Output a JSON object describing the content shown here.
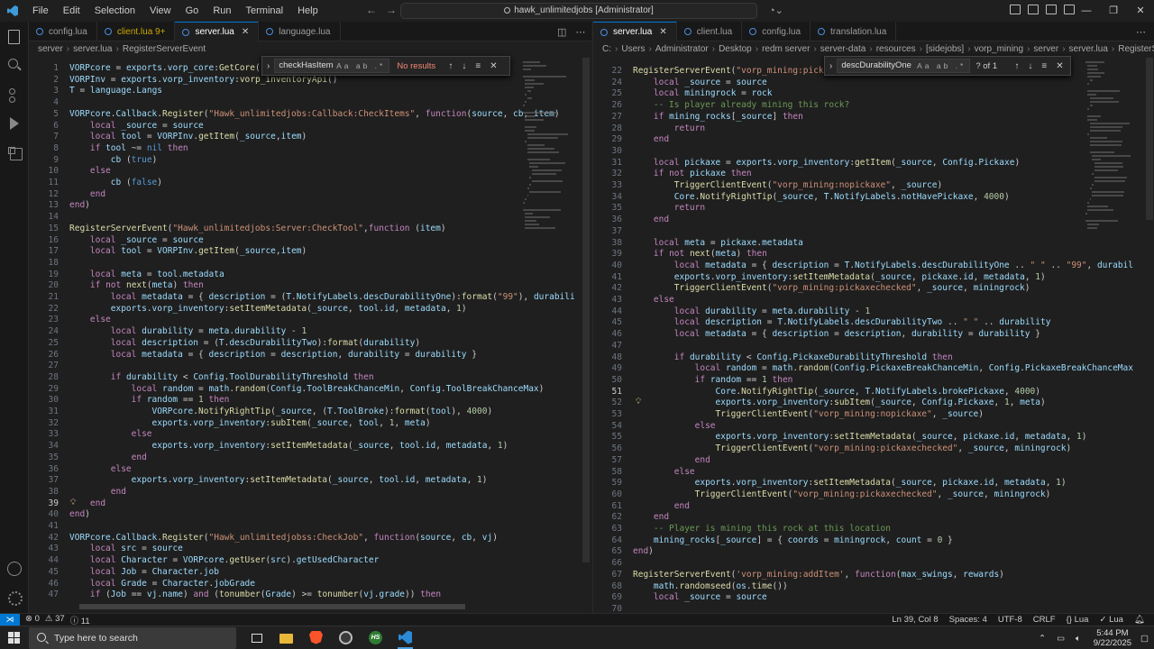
{
  "window": {
    "title": "hawk_unlimitedjobs [Administrator]"
  },
  "menu": [
    "File",
    "Edit",
    "Selection",
    "View",
    "Go",
    "Run",
    "Terminal",
    "Help"
  ],
  "left": {
    "tabs": [
      {
        "label": "config.lua",
        "active": false,
        "mod": false
      },
      {
        "label": "client.lua 9+",
        "active": false,
        "mod": true
      },
      {
        "label": "server.lua",
        "active": true,
        "mod": false
      },
      {
        "label": "language.lua",
        "active": false,
        "mod": false
      }
    ],
    "breadcrumb": [
      "server",
      "server.lua",
      "RegisterServerEvent"
    ],
    "find": {
      "query": "checkHasItem",
      "result": "No results"
    },
    "lines": [
      {
        "n": "1",
        "t": "VORPcore = exports.vorp_core:GetCore()"
      },
      {
        "n": "2",
        "t": "VORPInv = exports.vorp_inventory:vorp_inventoryApi()"
      },
      {
        "n": "3",
        "t": "T = language.Langs"
      },
      {
        "n": "4",
        "t": ""
      },
      {
        "n": "5",
        "t": "VORPcore.Callback.Register(\"Hawk_unlimitedjobs:Callback:CheckItems\", function(source, cb, item)"
      },
      {
        "n": "6",
        "t": "    local _source = source"
      },
      {
        "n": "7",
        "t": "    local tool = VORPInv.getItem(_source,item)"
      },
      {
        "n": "8",
        "t": "    if tool ~= nil then"
      },
      {
        "n": "9",
        "t": "        cb (true)"
      },
      {
        "n": "10",
        "t": "    else"
      },
      {
        "n": "11",
        "t": "        cb (false)"
      },
      {
        "n": "12",
        "t": "    end"
      },
      {
        "n": "13",
        "t": "end)"
      },
      {
        "n": "14",
        "t": ""
      },
      {
        "n": "15",
        "t": "RegisterServerEvent(\"Hawk_unlimitedjobs:Server:CheckTool\",function (item)"
      },
      {
        "n": "16",
        "t": "    local _source = source"
      },
      {
        "n": "17",
        "t": "    local tool = VORPInv.getItem(_source,item)"
      },
      {
        "n": "18",
        "t": ""
      },
      {
        "n": "19",
        "t": "    local meta = tool.metadata"
      },
      {
        "n": "20",
        "t": "    if not next(meta) then"
      },
      {
        "n": "21",
        "t": "        local metadata = { description = (T.NotifyLabels.descDurabilityOne):format(\"99\"), durabili"
      },
      {
        "n": "22",
        "t": "        exports.vorp_inventory:setItemMetadata(_source, tool.id, metadata, 1)"
      },
      {
        "n": "23",
        "t": "    else"
      },
      {
        "n": "24",
        "t": "        local durability = meta.durability - 1"
      },
      {
        "n": "25",
        "t": "        local description = (T.descDurabilityTwo):format(durability)"
      },
      {
        "n": "26",
        "t": "        local metadata = { description = description, durability = durability }"
      },
      {
        "n": "27",
        "t": ""
      },
      {
        "n": "28",
        "t": "        if durability < Config.ToolDurabilityThreshold then"
      },
      {
        "n": "29",
        "t": "            local random = math.random(Config.ToolBreakChanceMin, Config.ToolBreakChanceMax)"
      },
      {
        "n": "30",
        "t": "            if random == 1 then"
      },
      {
        "n": "31",
        "t": "                VORPcore.NotifyRightTip(_source, (T.ToolBroke):format(tool), 4000)"
      },
      {
        "n": "32",
        "t": "                exports.vorp_inventory:subItem(_source, tool, 1, meta)"
      },
      {
        "n": "33",
        "t": "            else"
      },
      {
        "n": "34",
        "t": "                exports.vorp_inventory:setItemMetadata(_source, tool.id, metadata, 1)"
      },
      {
        "n": "35",
        "t": "            end"
      },
      {
        "n": "36",
        "t": "        else"
      },
      {
        "n": "37",
        "t": "            exports.vorp_inventory:setItemMetadata(_source, tool.id, metadata, 1)"
      },
      {
        "n": "38",
        "t": "        end"
      },
      {
        "n": "39",
        "t": "    end"
      },
      {
        "n": "40",
        "t": "end)"
      },
      {
        "n": "41",
        "t": ""
      },
      {
        "n": "42",
        "t": "VORPcore.Callback.Register(\"Hawk_unlimitedjobss:CheckJob\", function(source, cb, vj)"
      },
      {
        "n": "43",
        "t": "    local src = source"
      },
      {
        "n": "44",
        "t": "    local Character = VORPcore.getUser(src).getUsedCharacter"
      },
      {
        "n": "45",
        "t": "    local Job = Character.job"
      },
      {
        "n": "46",
        "t": "    local Grade = Character.jobGrade"
      },
      {
        "n": "47",
        "t": "    if (Job == vj.name) and (tonumber(Grade) >= tonumber(vj.grade)) then"
      }
    ]
  },
  "right": {
    "tabs": [
      {
        "label": "server.lua",
        "active": true,
        "mod": false
      },
      {
        "label": "client.lua",
        "active": false,
        "mod": false
      },
      {
        "label": "config.lua",
        "active": false,
        "mod": false
      },
      {
        "label": "translation.lua",
        "active": false,
        "mod": false
      }
    ],
    "breadcrumb": [
      "C:",
      "Users",
      "Administrator",
      "Desktop",
      "redm server",
      "server-data",
      "resources",
      "[sidejobs]",
      "vorp_mining",
      "server",
      "server.lua",
      "RegisterServerEvent"
    ],
    "find": {
      "query": "descDurabilityOne",
      "result": "? of 1"
    },
    "lines": [
      {
        "n": "22",
        "t": "RegisterServerEvent(\"vorp_mining:pickaxec"
      },
      {
        "n": "24",
        "t": "    local _source = source"
      },
      {
        "n": "25",
        "t": "    local miningrock = rock"
      },
      {
        "n": "26",
        "t": "    -- Is player already mining this rock?"
      },
      {
        "n": "27",
        "t": "    if mining_rocks[_source] then"
      },
      {
        "n": "28",
        "t": "        return"
      },
      {
        "n": "29",
        "t": "    end"
      },
      {
        "n": "30",
        "t": ""
      },
      {
        "n": "31",
        "t": "    local pickaxe = exports.vorp_inventory:getItem(_source, Config.Pickaxe)"
      },
      {
        "n": "32",
        "t": "    if not pickaxe then"
      },
      {
        "n": "33",
        "t": "        TriggerClientEvent(\"vorp_mining:nopickaxe\", _source)"
      },
      {
        "n": "34",
        "t": "        Core.NotifyRightTip(_source, T.NotifyLabels.notHavePickaxe, 4000)"
      },
      {
        "n": "35",
        "t": "        return"
      },
      {
        "n": "36",
        "t": "    end"
      },
      {
        "n": "37",
        "t": ""
      },
      {
        "n": "38",
        "t": "    local meta = pickaxe.metadata"
      },
      {
        "n": "39",
        "t": "    if not next(meta) then"
      },
      {
        "n": "40",
        "t": "        local metadata = { description = T.NotifyLabels.descDurabilityOne .. \" \" .. \"99\", durabil"
      },
      {
        "n": "41",
        "t": "        exports.vorp_inventory:setItemMetadata(_source, pickaxe.id, metadata, 1)"
      },
      {
        "n": "42",
        "t": "        TriggerClientEvent(\"vorp_mining:pickaxechecked\", _source, miningrock)"
      },
      {
        "n": "43",
        "t": "    else"
      },
      {
        "n": "44",
        "t": "        local durability = meta.durability - 1"
      },
      {
        "n": "45",
        "t": "        local description = T.NotifyLabels.descDurabilityTwo .. \" \" .. durability"
      },
      {
        "n": "46",
        "t": "        local metadata = { description = description, durability = durability }"
      },
      {
        "n": "47",
        "t": ""
      },
      {
        "n": "48",
        "t": "        if durability < Config.PickaxeDurabilityThreshold then"
      },
      {
        "n": "49",
        "t": "            local random = math.random(Config.PickaxeBreakChanceMin, Config.PickaxeBreakChanceMax"
      },
      {
        "n": "50",
        "t": "            if random == 1 then"
      },
      {
        "n": "51",
        "t": "                Core.NotifyRightTip(_source, T.NotifyLabels.brokePickaxe, 4000)"
      },
      {
        "n": "52",
        "t": "                exports.vorp_inventory:subItem(_source, Config.Pickaxe, 1, meta)"
      },
      {
        "n": "53",
        "t": "                TriggerClientEvent(\"vorp_mining:nopickaxe\", _source)"
      },
      {
        "n": "54",
        "t": "            else"
      },
      {
        "n": "55",
        "t": "                exports.vorp_inventory:setItemMetadata(_source, pickaxe.id, metadata, 1)"
      },
      {
        "n": "56",
        "t": "                TriggerClientEvent(\"vorp_mining:pickaxechecked\", _source, miningrock)"
      },
      {
        "n": "57",
        "t": "            end"
      },
      {
        "n": "58",
        "t": "        else"
      },
      {
        "n": "59",
        "t": "            exports.vorp_inventory:setItemMetadata(_source, pickaxe.id, metadata, 1)"
      },
      {
        "n": "60",
        "t": "            TriggerClientEvent(\"vorp_mining:pickaxechecked\", _source, miningrock)"
      },
      {
        "n": "61",
        "t": "        end"
      },
      {
        "n": "62",
        "t": "    end"
      },
      {
        "n": "63",
        "t": "    -- Player is mining this rock at this location"
      },
      {
        "n": "64",
        "t": "    mining_rocks[_source] = { coords = miningrock, count = 0 }"
      },
      {
        "n": "65",
        "t": "end)"
      },
      {
        "n": "66",
        "t": ""
      },
      {
        "n": "67",
        "t": "RegisterServerEvent('vorp_mining:addItem', function(max_swings, rewards)"
      },
      {
        "n": "68",
        "t": "    math.randomseed(os.time())"
      },
      {
        "n": "69",
        "t": "    local _source = source"
      },
      {
        "n": "70",
        "t": ""
      }
    ]
  },
  "status": {
    "errors": "0",
    "warnings": "37",
    "info": "11",
    "position": "Ln 39, Col 8",
    "spaces": "Spaces: 4",
    "encoding": "UTF-8",
    "eol": "CRLF",
    "language": "Lua",
    "lang2": "Lua"
  },
  "taskbar": {
    "search_placeholder": "Type here to search",
    "time": "5:44 PM",
    "date": "9/22/2025"
  },
  "colors": {
    "keyword": "#c586c0",
    "keyword2": "#569cd6",
    "string": "#ce9178",
    "number": "#b5cea8",
    "function": "#dcdcaa",
    "variable": "#9cdcfe",
    "comment": "#6a9955",
    "accent": "#0078d4"
  }
}
